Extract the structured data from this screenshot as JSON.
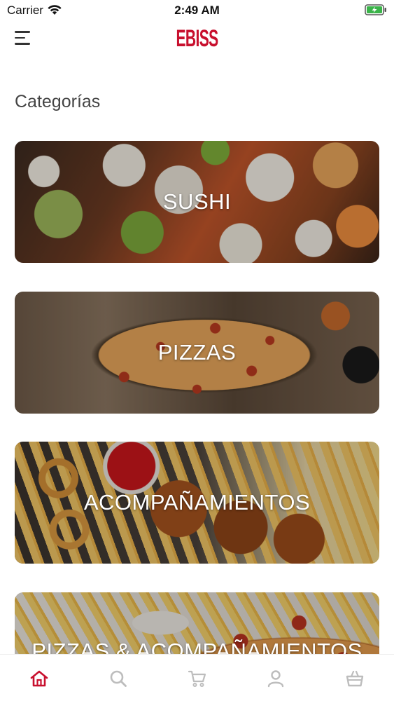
{
  "status_bar": {
    "carrier": "Carrier",
    "time": "2:49 AM",
    "battery_color": "#3bb44a"
  },
  "header": {
    "logo_text": "EBISS",
    "logo_color": "#c8102e",
    "menu_icon": "hamburger-menu-icon"
  },
  "section": {
    "title": "Categorías"
  },
  "categories": [
    {
      "label": "SUSHI"
    },
    {
      "label": "PIZZAS"
    },
    {
      "label": "ACOMPAÑAMIENTOS"
    },
    {
      "label": "PIZZAS & ACOMPAÑAMIENTOS"
    }
  ],
  "tab_bar": {
    "active_color": "#c8102e",
    "inactive_color": "#bdbdbd",
    "tabs": [
      {
        "icon": "home-icon",
        "active": true
      },
      {
        "icon": "search-icon",
        "active": false
      },
      {
        "icon": "cart-icon",
        "active": false
      },
      {
        "icon": "profile-icon",
        "active": false
      },
      {
        "icon": "basket-icon",
        "active": false
      }
    ]
  }
}
